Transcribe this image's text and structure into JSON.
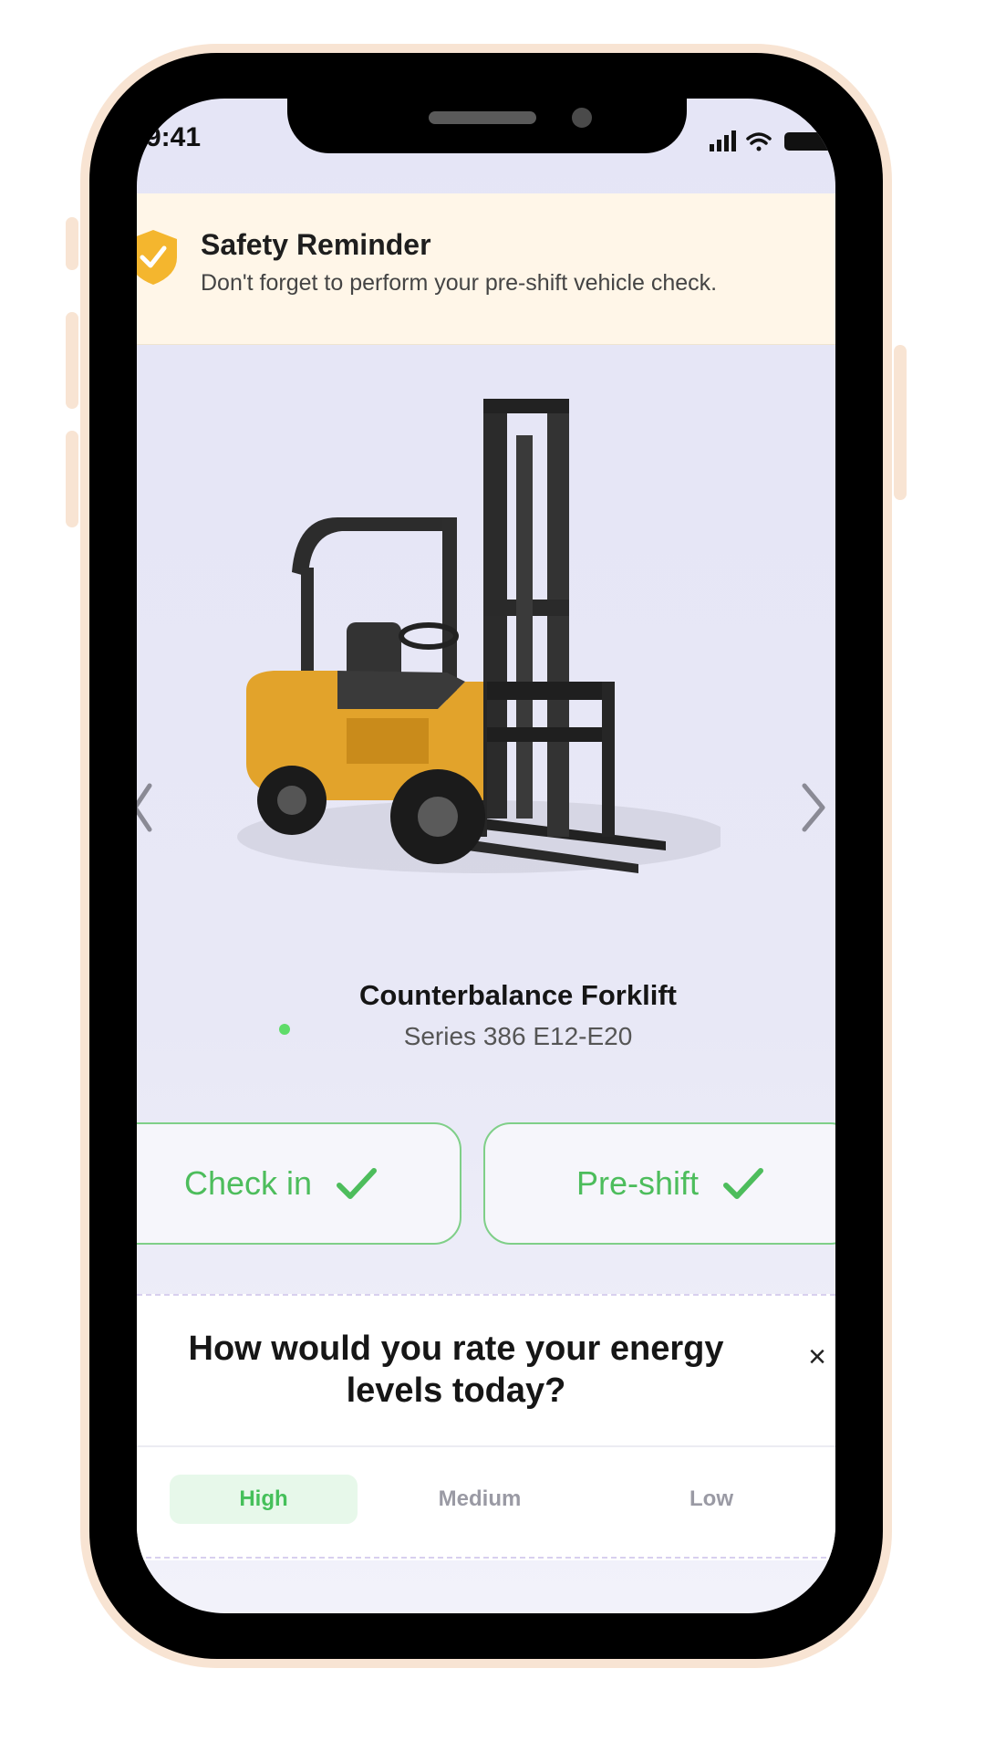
{
  "status_bar": {
    "time": "9:41"
  },
  "banner": {
    "title": "Safety Reminder",
    "message": "Don't forget to perform your pre-shift vehicle check."
  },
  "vehicle": {
    "name": "Counterbalance Forklift",
    "series": "Series 386 E12-E20"
  },
  "actions": {
    "checkin_label": "Check in",
    "preshift_label": "Pre-shift"
  },
  "survey": {
    "question_line1": "How would you rate your energy",
    "question_line2": "levels today?",
    "close_symbol": "×",
    "options": [
      "High",
      "Medium",
      "Low"
    ],
    "selected": "High"
  },
  "colors": {
    "accent_green": "#4dbd5c",
    "banner_bg": "#fff6e8",
    "shield_yellow": "#f4b62e",
    "phone_frame": "#f8e4d3"
  },
  "icons": [
    "shield-check-icon",
    "chevron-left-icon",
    "chevron-right-icon",
    "checkmark-icon",
    "close-icon",
    "signal-icon",
    "wifi-icon",
    "battery-icon"
  ]
}
